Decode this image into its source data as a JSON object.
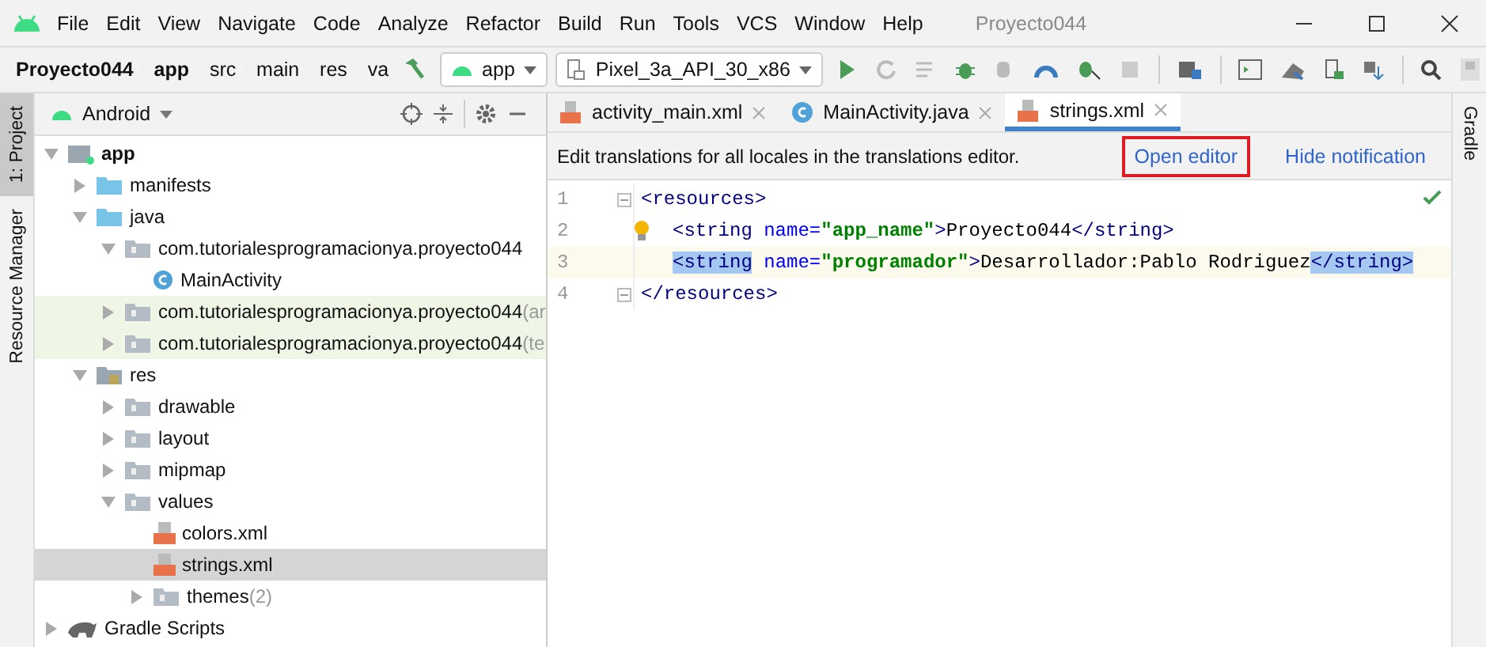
{
  "window": {
    "title": "Proyecto044"
  },
  "menu": [
    "File",
    "Edit",
    "View",
    "Navigate",
    "Code",
    "Analyze",
    "Refactor",
    "Build",
    "Run",
    "Tools",
    "VCS",
    "Window",
    "Help"
  ],
  "breadcrumb": [
    {
      "label": "Proyecto044",
      "bold": true
    },
    {
      "label": "app",
      "bold": true
    },
    {
      "label": "src",
      "bold": false
    },
    {
      "label": "main",
      "bold": false
    },
    {
      "label": "res",
      "bold": false
    },
    {
      "label": "va",
      "bold": false
    }
  ],
  "run_config": "app",
  "device": "Pixel_3a_API_30_x86",
  "left_tabs": [
    {
      "label": "1: Project",
      "selected": true
    },
    {
      "label": "Resource Manager",
      "selected": false
    }
  ],
  "right_tabs": [
    {
      "label": "Gradle",
      "selected": false
    }
  ],
  "project_panel": {
    "view": "Android",
    "tree": [
      {
        "label": "app",
        "kind": "module",
        "bold": true,
        "expanded": true,
        "selected": false,
        "tinted": false,
        "children": [
          {
            "label": "manifests",
            "kind": "folder",
            "expanded": false,
            "selected": false,
            "tinted": false
          },
          {
            "label": "java",
            "kind": "folder",
            "expanded": true,
            "selected": false,
            "tinted": false,
            "children": [
              {
                "label": "com.tutorialesprogramacionya.proyecto044",
                "kind": "package",
                "expanded": true,
                "selected": false,
                "tinted": false,
                "children": [
                  {
                    "label": "MainActivity",
                    "kind": "class",
                    "selected": false,
                    "tinted": false
                  }
                ]
              },
              {
                "label": "com.tutorialesprogramacionya.proyecto044",
                "suffix": "(ar",
                "kind": "package",
                "expanded": false,
                "selected": false,
                "tinted": true
              },
              {
                "label": "com.tutorialesprogramacionya.proyecto044",
                "suffix": "(te",
                "kind": "package",
                "expanded": false,
                "selected": false,
                "tinted": true
              }
            ]
          },
          {
            "label": "res",
            "kind": "resfolder",
            "expanded": true,
            "selected": false,
            "tinted": false,
            "children": [
              {
                "label": "drawable",
                "kind": "package",
                "expanded": false,
                "selected": false,
                "tinted": false
              },
              {
                "label": "layout",
                "kind": "package",
                "expanded": false,
                "selected": false,
                "tinted": false
              },
              {
                "label": "mipmap",
                "kind": "package",
                "expanded": false,
                "selected": false,
                "tinted": false
              },
              {
                "label": "values",
                "kind": "package",
                "expanded": true,
                "selected": false,
                "tinted": false,
                "children": [
                  {
                    "label": "colors.xml",
                    "kind": "xml",
                    "selected": false,
                    "tinted": false
                  },
                  {
                    "label": "strings.xml",
                    "kind": "xml",
                    "selected": true,
                    "tinted": false
                  },
                  {
                    "label": "themes",
                    "suffix": "(2)",
                    "kind": "package",
                    "expanded": false,
                    "selected": false,
                    "tinted": false
                  }
                ]
              }
            ]
          }
        ]
      },
      {
        "label": "Gradle Scripts",
        "kind": "gradle",
        "expanded": false,
        "selected": false,
        "tinted": false
      }
    ]
  },
  "editor_tabs": [
    {
      "label": "activity_main.xml",
      "kind": "xml",
      "selected": false
    },
    {
      "label": "MainActivity.java",
      "kind": "class",
      "selected": false
    },
    {
      "label": "strings.xml",
      "kind": "xml",
      "selected": true
    }
  ],
  "notification": {
    "text": "Edit translations for all locales in the translations editor.",
    "links": [
      {
        "label": "Open editor",
        "highlighted": true
      },
      {
        "label": "Hide notification",
        "highlighted": false
      }
    ]
  },
  "code": [
    {
      "number": "1",
      "current": false,
      "bulb": false,
      "fold": true,
      "tokens": [
        {
          "text": "<resources>",
          "kind": "tag",
          "matched": false
        }
      ]
    },
    {
      "number": "2",
      "current": false,
      "bulb": true,
      "fold": false,
      "tokens": [
        {
          "text": "<string ",
          "kind": "tag",
          "matched": false
        },
        {
          "text": "name=",
          "kind": "attr",
          "matched": false
        },
        {
          "text": "\"app_name\"",
          "kind": "value",
          "matched": false
        },
        {
          "text": ">",
          "kind": "tag",
          "matched": false
        },
        {
          "text": "Proyecto044",
          "kind": "text",
          "matched": false
        },
        {
          "text": "</string>",
          "kind": "tag",
          "matched": false
        }
      ]
    },
    {
      "number": "3",
      "current": true,
      "bulb": false,
      "fold": false,
      "tokens": [
        {
          "text": "<string",
          "kind": "tag",
          "matched": true
        },
        {
          "text": " name=",
          "kind": "attr",
          "matched": false
        },
        {
          "text": "\"programador\"",
          "kind": "value",
          "matched": false
        },
        {
          "text": ">",
          "kind": "tag",
          "matched": false
        },
        {
          "text": "Desarrollador:Pablo Rodriguez",
          "kind": "text",
          "matched": false
        },
        {
          "text": "</string>",
          "kind": "tag",
          "matched": true
        }
      ]
    },
    {
      "number": "4",
      "current": false,
      "bulb": false,
      "fold": true,
      "tokens": [
        {
          "text": "</resources>",
          "kind": "tag",
          "matched": false
        }
      ]
    }
  ]
}
